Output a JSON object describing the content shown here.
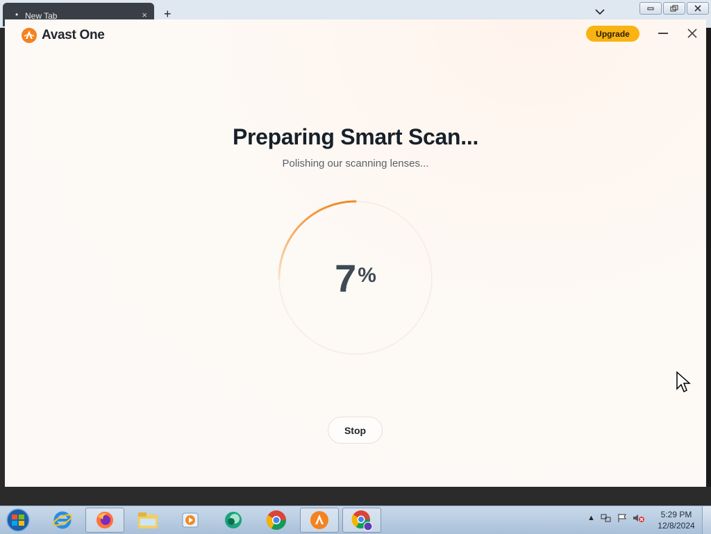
{
  "browser": {
    "tab_title": "New Tab",
    "new_tab_symbol": "+",
    "close_symbol": "×"
  },
  "app": {
    "brand_name": "Avast One",
    "upgrade_label": "Upgrade",
    "heading": "Preparing Smart Scan...",
    "subheading": "Polishing our scanning lenses...",
    "progress_value": "7",
    "progress_unit": "%",
    "progress_fraction": 0.07,
    "stop_label": "Stop",
    "accent_color": "#f08a24",
    "upgrade_color": "#f9b312"
  },
  "taskbar": {
    "items": [
      "start-orb-icon",
      "internet-explorer-icon",
      "firefox-icon",
      "file-explorer-icon",
      "media-player-icon",
      "app-icon",
      "chrome-icon",
      "avast-icon",
      "chrome-profile-icon"
    ],
    "clock_time": "5:29 PM",
    "clock_date": "12/8/2024"
  }
}
